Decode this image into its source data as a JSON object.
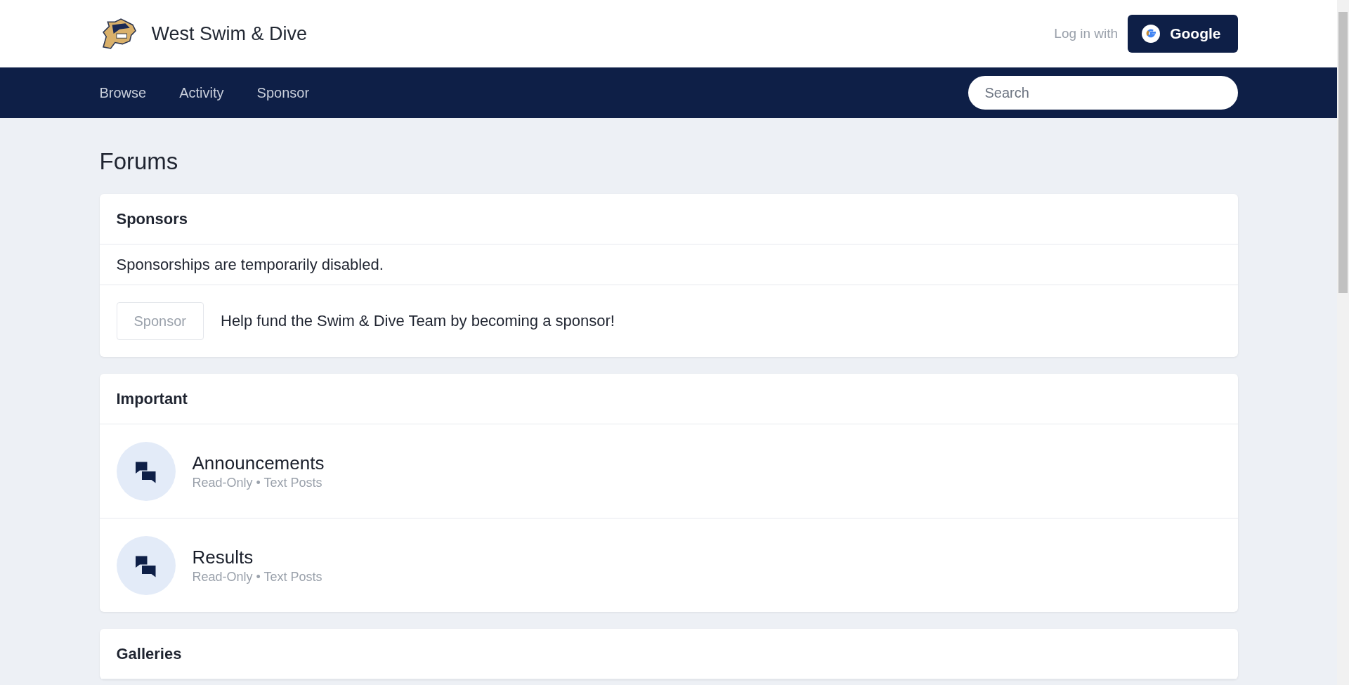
{
  "site": {
    "title": "West Swim & Dive"
  },
  "login": {
    "label": "Log in with",
    "button": "Google"
  },
  "nav": {
    "links": [
      {
        "label": "Browse"
      },
      {
        "label": "Activity"
      },
      {
        "label": "Sponsor"
      }
    ],
    "search": {
      "placeholder": "Search"
    }
  },
  "page_title": "Forums",
  "sections": [
    {
      "title": "Sponsors",
      "rows": [
        {
          "kind": "notice",
          "text": "Sponsorships are temporarily disabled."
        },
        {
          "kind": "action",
          "button": "Sponsor",
          "disabled": true,
          "text": "Help fund the Swim & Dive Team by becoming a sponsor!"
        }
      ]
    },
    {
      "title": "Important",
      "rows": [
        {
          "kind": "forum",
          "name": "Announcements",
          "meta": "Read-Only • Text Posts"
        },
        {
          "kind": "forum",
          "name": "Results",
          "meta": "Read-Only • Text Posts"
        }
      ]
    },
    {
      "title": "Galleries"
    }
  ]
}
